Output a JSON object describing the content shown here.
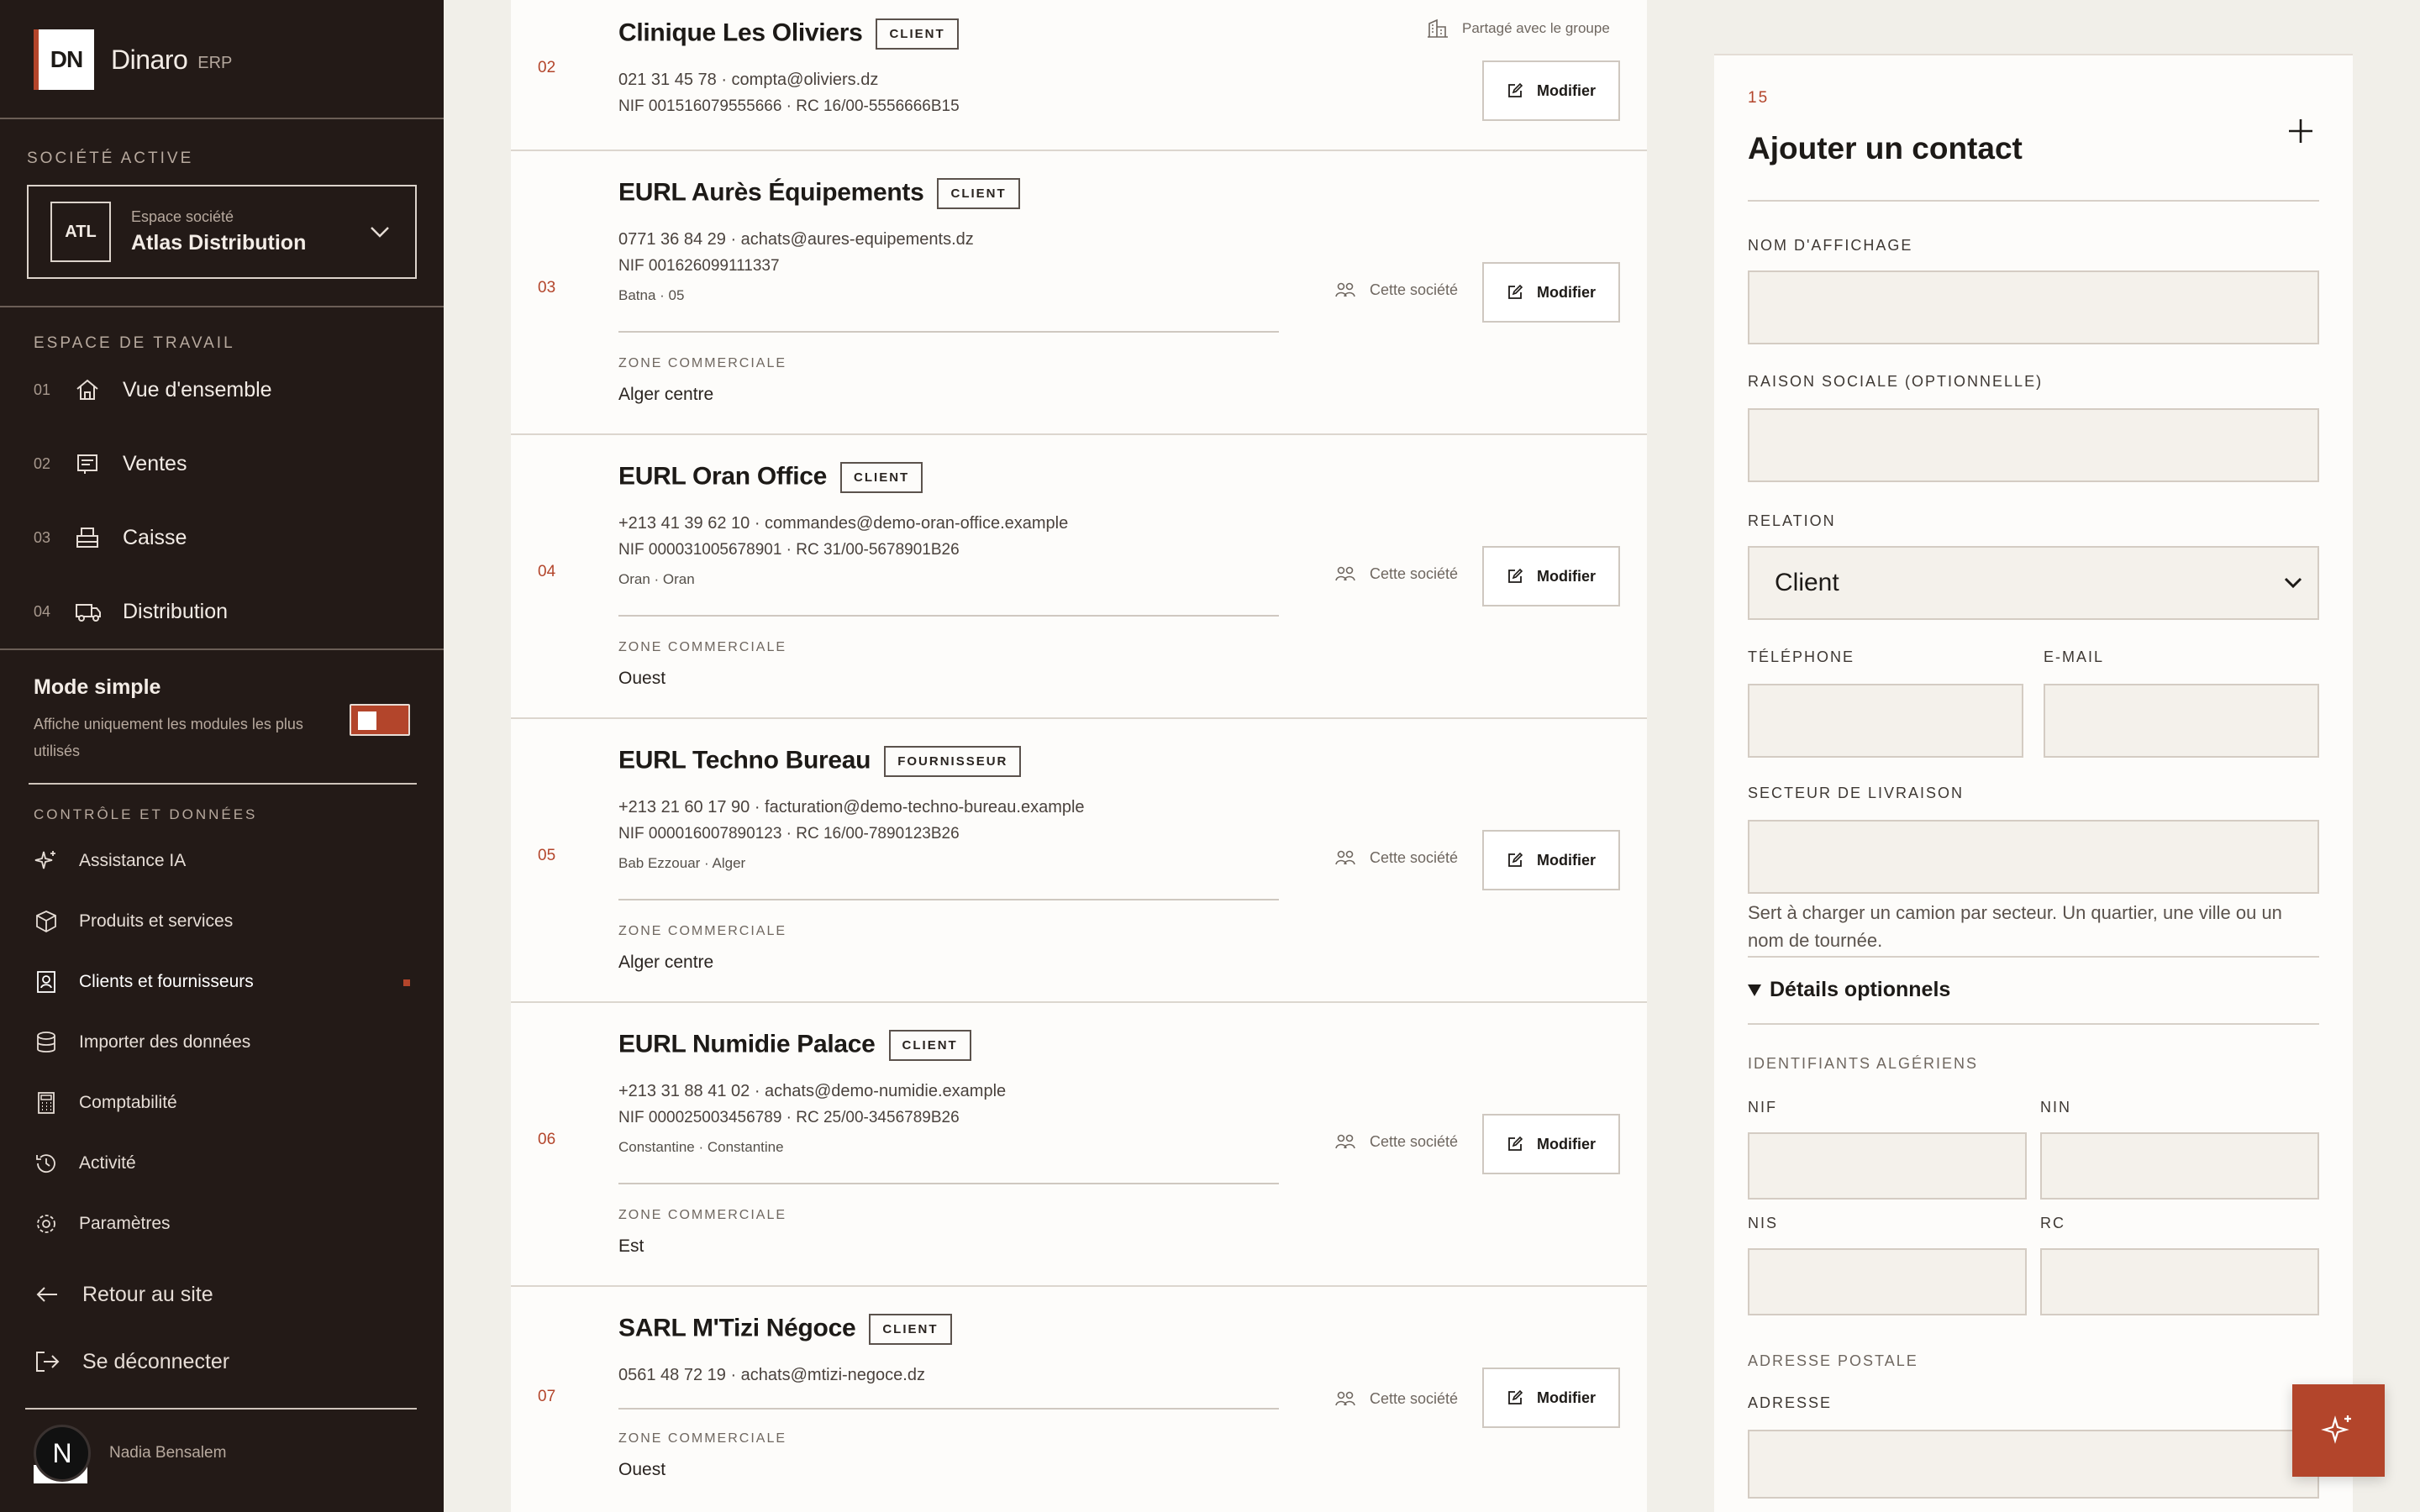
{
  "brand": {
    "logo": "DN",
    "name": "Dinaro",
    "suffix": "ERP"
  },
  "company": {
    "section": "SOCIÉTÉ ACTIVE",
    "badge": "ATL",
    "small": "Espace société",
    "name": "Atlas Distribution"
  },
  "workspace": {
    "section": "ESPACE DE TRAVAIL",
    "items": [
      {
        "num": "01",
        "label": "Vue d'ensemble",
        "icon": "home-icon"
      },
      {
        "num": "02",
        "label": "Ventes",
        "icon": "receipt-icon"
      },
      {
        "num": "03",
        "label": "Caisse",
        "icon": "register-icon"
      },
      {
        "num": "04",
        "label": "Distribution",
        "icon": "truck-icon"
      }
    ]
  },
  "mode": {
    "title": "Mode simple",
    "desc": "Affiche uniquement les modules les plus utilisés",
    "enabled": true
  },
  "controls": {
    "section": "CONTRÔLE ET DONNÉES",
    "items": [
      {
        "label": "Assistance IA",
        "icon": "sparkle-icon"
      },
      {
        "label": "Produits et services",
        "icon": "box-icon"
      },
      {
        "label": "Clients et fournisseurs",
        "icon": "contacts-icon",
        "active": true
      },
      {
        "label": "Importer des données",
        "icon": "database-icon"
      },
      {
        "label": "Comptabilité",
        "icon": "calculator-icon"
      },
      {
        "label": "Activité",
        "icon": "history-icon"
      },
      {
        "label": "Paramètres",
        "icon": "gear-icon"
      }
    ]
  },
  "bottom": {
    "back": "Retour au site",
    "logout": "Se déconnecter"
  },
  "user": {
    "initial": "N",
    "name": "Nadia Bensalem"
  },
  "contacts": [
    {
      "num": "02",
      "name": "Clinique Les Oliviers",
      "tag": "CLIENT",
      "line1": "021 31 45 78 · compta@oliviers.dz",
      "line2": "NIF 001516079555666 · RC 16/00-5556666B15",
      "scope": "Partagé avec le groupe",
      "edit": "Modifier"
    },
    {
      "num": "03",
      "name": "EURL Aurès Équipements",
      "tag": "CLIENT",
      "line1": "0771 36 84 29 · achats@aures-equipements.dz",
      "line2": "NIF 001626099111337",
      "location": "Batna · 05",
      "zone_label": "ZONE COMMERCIALE",
      "zone": "Alger centre",
      "scope": "Cette société",
      "edit": "Modifier"
    },
    {
      "num": "04",
      "name": "EURL Oran Office",
      "tag": "CLIENT",
      "line1": "+213 41 39 62 10 · commandes@demo-oran-office.example",
      "line2": "NIF 000031005678901 · RC 31/00-5678901B26",
      "location": "Oran · Oran",
      "zone_label": "ZONE COMMERCIALE",
      "zone": "Ouest",
      "scope": "Cette société",
      "edit": "Modifier"
    },
    {
      "num": "05",
      "name": "EURL Techno Bureau",
      "tag": "FOURNISSEUR",
      "line1": "+213 21 60 17 90 · facturation@demo-techno-bureau.example",
      "line2": "NIF 000016007890123 · RC 16/00-7890123B26",
      "location": "Bab Ezzouar · Alger",
      "zone_label": "ZONE COMMERCIALE",
      "zone": "Alger centre",
      "scope": "Cette société",
      "edit": "Modifier"
    },
    {
      "num": "06",
      "name": "EURL Numidie Palace",
      "tag": "CLIENT",
      "line1": "+213 31 88 41 02 · achats@demo-numidie.example",
      "line2": "NIF 000025003456789 · RC 25/00-3456789B26",
      "location": "Constantine · Constantine",
      "zone_label": "ZONE COMMERCIALE",
      "zone": "Est",
      "scope": "Cette société",
      "edit": "Modifier"
    },
    {
      "num": "07",
      "name": "SARL M'Tizi Négoce",
      "tag": "CLIENT",
      "line1": "0561 48 72 19 · achats@mtizi-negoce.dz",
      "zone_label": "ZONE COMMERCIALE",
      "zone": "Ouest",
      "scope": "Cette société",
      "edit": "Modifier"
    }
  ],
  "form": {
    "num": "15",
    "title": "Ajouter un contact",
    "display_name": "NOM D'AFFICHAGE",
    "company_name": "RAISON SOCIALE (OPTIONNELLE)",
    "relation": "RELATION",
    "relation_value": "Client",
    "phone": "TÉLÉPHONE",
    "email": "E-MAIL",
    "sector": "SECTEUR DE LIVRAISON",
    "sector_hint": "Sert à charger un camion par secteur. Un quartier, une ville ou un nom de tournée.",
    "details": "Détails optionnels",
    "ids": "IDENTIFIANTS ALGÉRIENS",
    "nif": "NIF",
    "nin": "NIN",
    "nis": "NIS",
    "rc": "RC",
    "postal": "ADRESSE POSTALE",
    "address": "ADRESSE"
  },
  "colors": {
    "accent": "#b3452b",
    "sidebar": "#231a17",
    "page": "#f1efe9"
  }
}
